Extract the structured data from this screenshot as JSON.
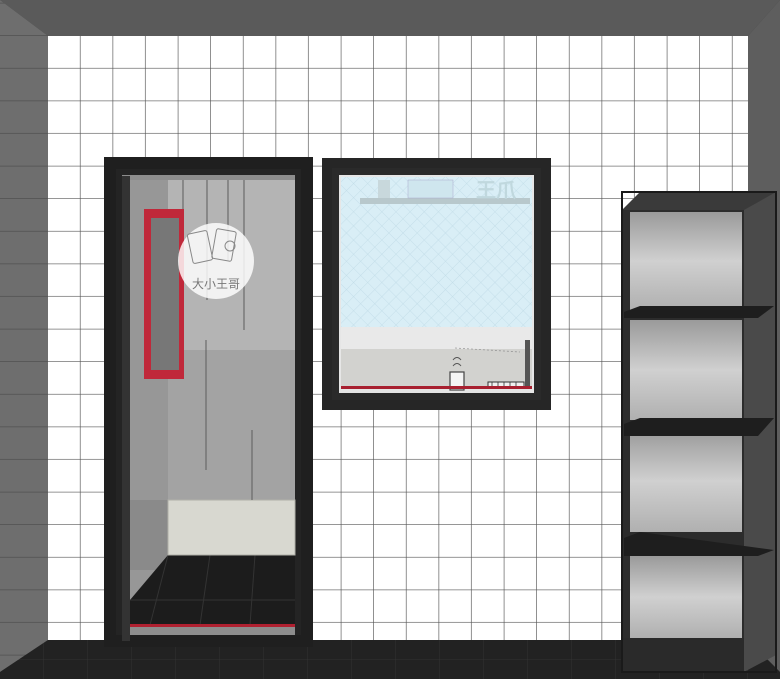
{
  "scene": {
    "watermark_text": "大小王哥",
    "window_sign_text": "王爪",
    "colors": {
      "wall_tile": "#ffffff",
      "grout": "#555555",
      "frame": "#2b2b2b",
      "accent_red": "#c0283a",
      "glass": "#d8eef5",
      "floor": "#1e1e1e"
    }
  }
}
